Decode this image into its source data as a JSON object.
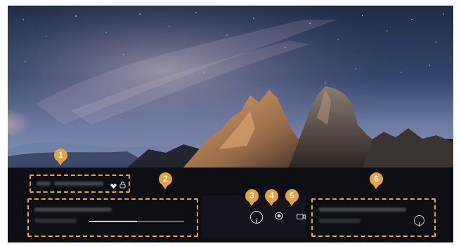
{
  "screen": {
    "title_blur": "",
    "info": {
      "subtitle_blur": "",
      "progress": 0.5
    },
    "controls": [
      {
        "key": "3",
        "icon": "info-icon"
      },
      {
        "key": "4",
        "icon": "record-icon"
      },
      {
        "key": "5",
        "icon": "camera-icon"
      }
    ],
    "right_card": {
      "info_icon": "info-icon"
    },
    "badges": [
      {
        "label": "1"
      },
      {
        "label": "2"
      },
      {
        "label": "3"
      },
      {
        "label": "4"
      },
      {
        "label": "5"
      },
      {
        "label": "6"
      }
    ],
    "icons": {
      "favorite": "heart-icon",
      "lock": "lock-icon"
    }
  },
  "colors": {
    "accent": "#e8a33a",
    "panel": "#0d0f14",
    "sky_top": "#233250",
    "sky_bottom": "#7d8db7"
  }
}
